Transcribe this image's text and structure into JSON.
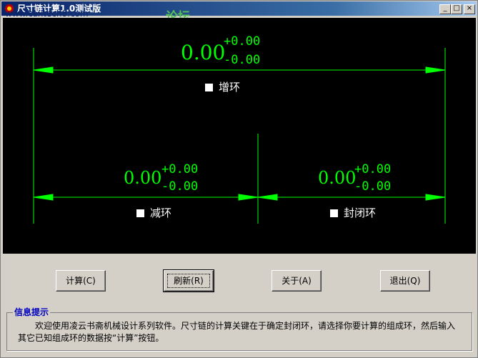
{
  "window": {
    "title": "尺寸链计算1.0测试版",
    "watermark_url": "www.caxtech8.com",
    "watermark_brand": "论坛",
    "minimize_glyph": "_",
    "maximize_glyph": "□",
    "close_glyph": "×"
  },
  "diagram": {
    "top_dim": {
      "value": "0.00",
      "upper_tol": "+0.00",
      "lower_tol": "-0.00",
      "label": "增环"
    },
    "left_dim": {
      "value": "0.00",
      "upper_tol": "+0.00",
      "lower_tol": "-0.00",
      "label": "减环"
    },
    "right_dim": {
      "value": "0.00",
      "upper_tol": "+0.00",
      "lower_tol": "-0.00",
      "label": "封闭环"
    },
    "line_color": "#00ff00"
  },
  "buttons": {
    "calc": "计算(C)",
    "refresh": "刷新(R)",
    "about": "关于(A)",
    "exit": "退出(Q)"
  },
  "info": {
    "title": "信息提示",
    "text": "欢迎使用凌云书斋机械设计系列软件。尺寸链的计算关键在于确定封闭环，请选择你要计算的组成环，然后输入其它已知组成环的数据按“计算”按钮。"
  }
}
